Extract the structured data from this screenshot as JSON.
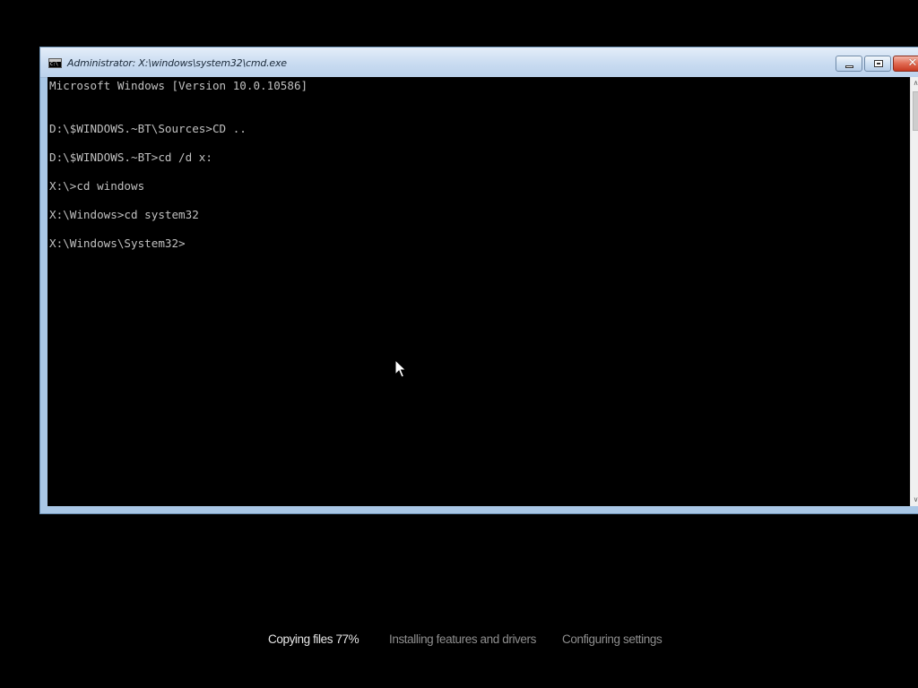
{
  "window": {
    "title": "Administrator: X:\\windows\\system32\\cmd.exe",
    "icon_text": "C:\\",
    "buttons": {
      "minimize": "minimize",
      "maximize": "maximize",
      "close": "✕"
    }
  },
  "console": {
    "lines": [
      "Microsoft Windows [Version 10.0.10586]",
      "",
      "",
      "D:\\$WINDOWS.~BT\\Sources>CD ..",
      "",
      "D:\\$WINDOWS.~BT>cd /d x:",
      "",
      "X:\\>cd windows",
      "",
      "X:\\Windows>cd system32",
      "",
      "X:\\Windows\\System32>"
    ]
  },
  "scrollbar": {
    "up_arrow": "∧",
    "down_arrow": "∨"
  },
  "setup_progress": {
    "steps": [
      {
        "label": "Copying files 77%",
        "state": "active"
      },
      {
        "label": "Installing features and drivers",
        "state": "pending"
      },
      {
        "label": "Configuring settings",
        "state": "pending"
      }
    ]
  },
  "colors": {
    "background": "#000000",
    "console_text": "#c0c0c0",
    "active_step": "#e6e6e6",
    "pending_step": "#8e8e8e"
  }
}
